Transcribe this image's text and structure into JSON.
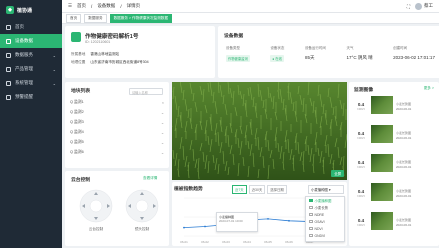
{
  "app": {
    "name": "植协通"
  },
  "sidebar": {
    "items": [
      {
        "label": "首页",
        "active": false
      },
      {
        "label": "设备数据",
        "active": true
      },
      {
        "label": "数据服务",
        "active": false
      },
      {
        "label": "产品管理",
        "active": false
      },
      {
        "label": "系统管理",
        "active": false
      },
      {
        "label": "预警提醒",
        "active": false
      }
    ]
  },
  "topbar": {
    "home": "首页",
    "crumb1": "设备数据",
    "crumb2": "详情页",
    "user": "蔡工"
  },
  "tabs": [
    "首页",
    "数据服务",
    "数据服务 > 作物健康状况监测数据"
  ],
  "device": {
    "name": "作物健康密码解析1号",
    "id": "ID: 1202110601",
    "kv": [
      {
        "k": "所属基地",
        "v": "香港山林地监测站"
      },
      {
        "k": "地理位置",
        "v": "山东省济南市历城区西北街道8号304"
      }
    ]
  },
  "stats": {
    "title": "设备数据",
    "cols": [
      {
        "label": "设备类型",
        "value": "作物健康监测"
      },
      {
        "label": "设备状态",
        "value": "● 在线"
      },
      {
        "label": "设备运行时间",
        "value": "85天"
      },
      {
        "label": "天气",
        "value": "17°C 阴风 晴"
      },
      {
        "label": "创建时间",
        "value": "2023-06-02 17:01:17"
      }
    ]
  },
  "plots": {
    "title": "地块列表",
    "search_placeholder": "请输入名称",
    "items": [
      "Q 监测1",
      "Q 监测2",
      "Q 监测3",
      "Q 监测4",
      "Q 监测5",
      "Q 监测6"
    ]
  },
  "video": {
    "button": "全屏"
  },
  "monitor": {
    "title": "监测图像",
    "more": "更多 >",
    "rows": [
      {
        "val": "0.4",
        "unit": "NDVI",
        "time": "2023-06-01",
        "place": "小麦长势图"
      },
      {
        "val": "0.4",
        "unit": "NDVI",
        "time": "2023-06-01",
        "place": "小麦长势图"
      },
      {
        "val": "0.4",
        "unit": "NDVI",
        "time": "2023-06-01",
        "place": "小麦长势图"
      },
      {
        "val": "0.4",
        "unit": "NDVI",
        "time": "2023-06-01",
        "place": "小麦长势图"
      },
      {
        "val": "0.4",
        "unit": "NDVI",
        "time": "2023-06-01",
        "place": "小麦长势图"
      }
    ]
  },
  "control": {
    "title": "云台控制",
    "link": "查看详情",
    "pan_label": "云台控制",
    "zoom_label": "镜头控制"
  },
  "trend": {
    "title": "植被指数趋势",
    "filters": [
      "近7天",
      "近30天",
      "选择日期"
    ],
    "select": "小麦播种图",
    "tooltip_title": "小麦播种图",
    "tooltip_time": "2023-07-01 10:00"
  },
  "chart_data": {
    "type": "line",
    "x": [
      "06-01",
      "06-02",
      "06-03",
      "06-04",
      "06-05",
      "06-06",
      "06-07"
    ],
    "series": [
      {
        "values": [
          0.22,
          0.25,
          0.3,
          0.42,
          0.45,
          0.4,
          0.38
        ]
      }
    ],
    "ylim": [
      0,
      1
    ],
    "ylabel": ""
  },
  "dropdown": {
    "items": [
      "小麦播种图",
      "小麦长势",
      "NDRE",
      "OSAVI",
      "NDVI",
      "GNDVI"
    ],
    "selected": 0
  },
  "colors": {
    "accent": "#2bb673",
    "sidebar": "#1f2a36"
  }
}
